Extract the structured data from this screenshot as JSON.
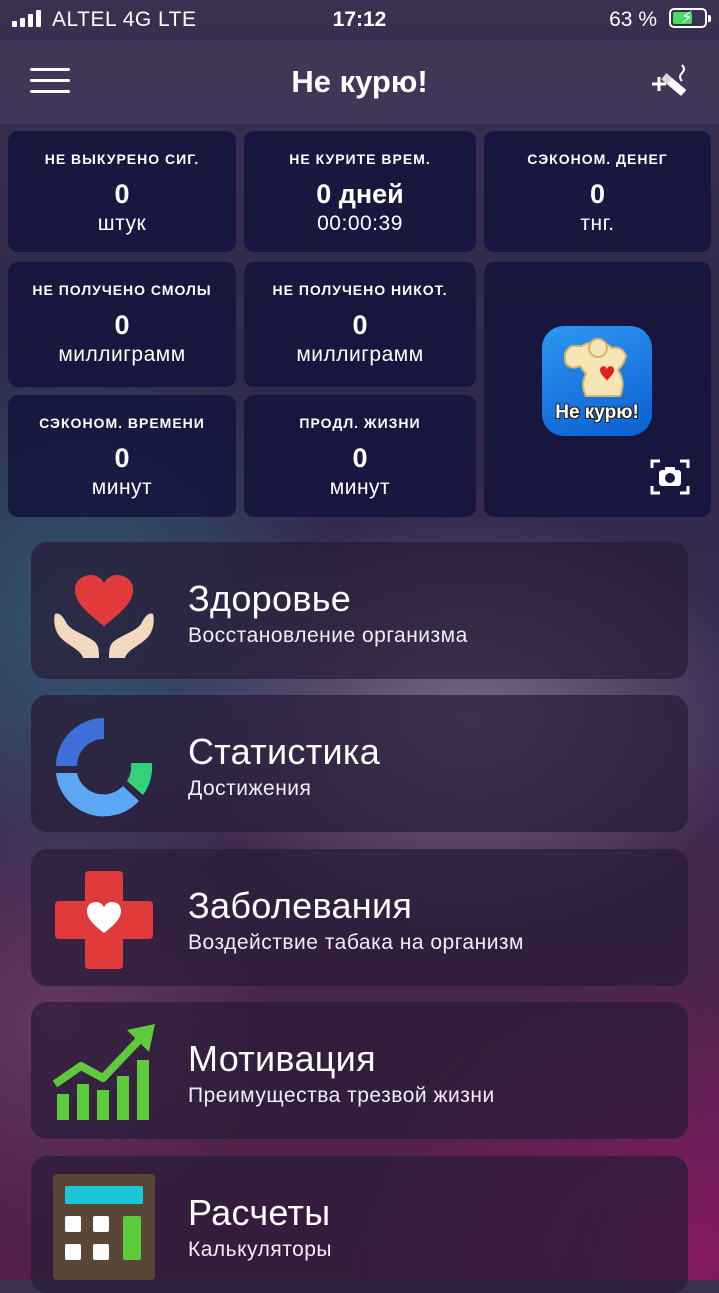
{
  "status": {
    "carrier": "ALTEL 4G  LTE",
    "time": "17:12",
    "battery": "63 %",
    "battery_level": 0.63
  },
  "header": {
    "title": "Не курю!"
  },
  "stats": [
    {
      "label": "НЕ ВЫКУРЕНО СИГ.",
      "value": "0",
      "unit": "штук"
    },
    {
      "label": "НЕ КУРИТЕ ВРЕМ.",
      "value": "0 дней",
      "unit": "00:00:39"
    },
    {
      "label": "СЭКОНОМ. ДЕНЕГ",
      "value": "0",
      "unit": "тнг."
    },
    {
      "label": "НЕ ПОЛУЧЕНО СМОЛЫ",
      "value": "0",
      "unit": "миллиграмм"
    },
    {
      "label": "НЕ ПОЛУЧЕНО НИКОТ.",
      "value": "0",
      "unit": "миллиграмм"
    },
    {
      "label": "СЭКОНОМ. ВРЕМЕНИ",
      "value": "0",
      "unit": "минут"
    },
    {
      "label": "ПРОДЛ. ЖИЗНИ",
      "value": "0",
      "unit": "минут"
    }
  ],
  "logo": {
    "text": "Не курю!"
  },
  "menu": [
    {
      "title": "Здоровье",
      "subtitle": "Восстановление организма",
      "icon": "heart-hands-icon"
    },
    {
      "title": "Статистика",
      "subtitle": "Достижения",
      "icon": "ring-chart-icon"
    },
    {
      "title": "Заболевания",
      "subtitle": "Воздействие табака на организм",
      "icon": "medical-cross-icon"
    },
    {
      "title": "Мотивация",
      "subtitle": "Преимущества трезвой жизни",
      "icon": "growth-chart-icon"
    },
    {
      "title": "Расчеты",
      "subtitle": "Калькуляторы",
      "icon": "calculator-icon"
    }
  ],
  "colors": {
    "stat_tile": "#12123c",
    "heart": "#e23b3b",
    "ring_blue": "#3f8ef2",
    "ring_green": "#33d17a",
    "cross": "#e03a3a",
    "chart_green": "#5ecb3d",
    "calc_screen": "#19c7d6"
  }
}
